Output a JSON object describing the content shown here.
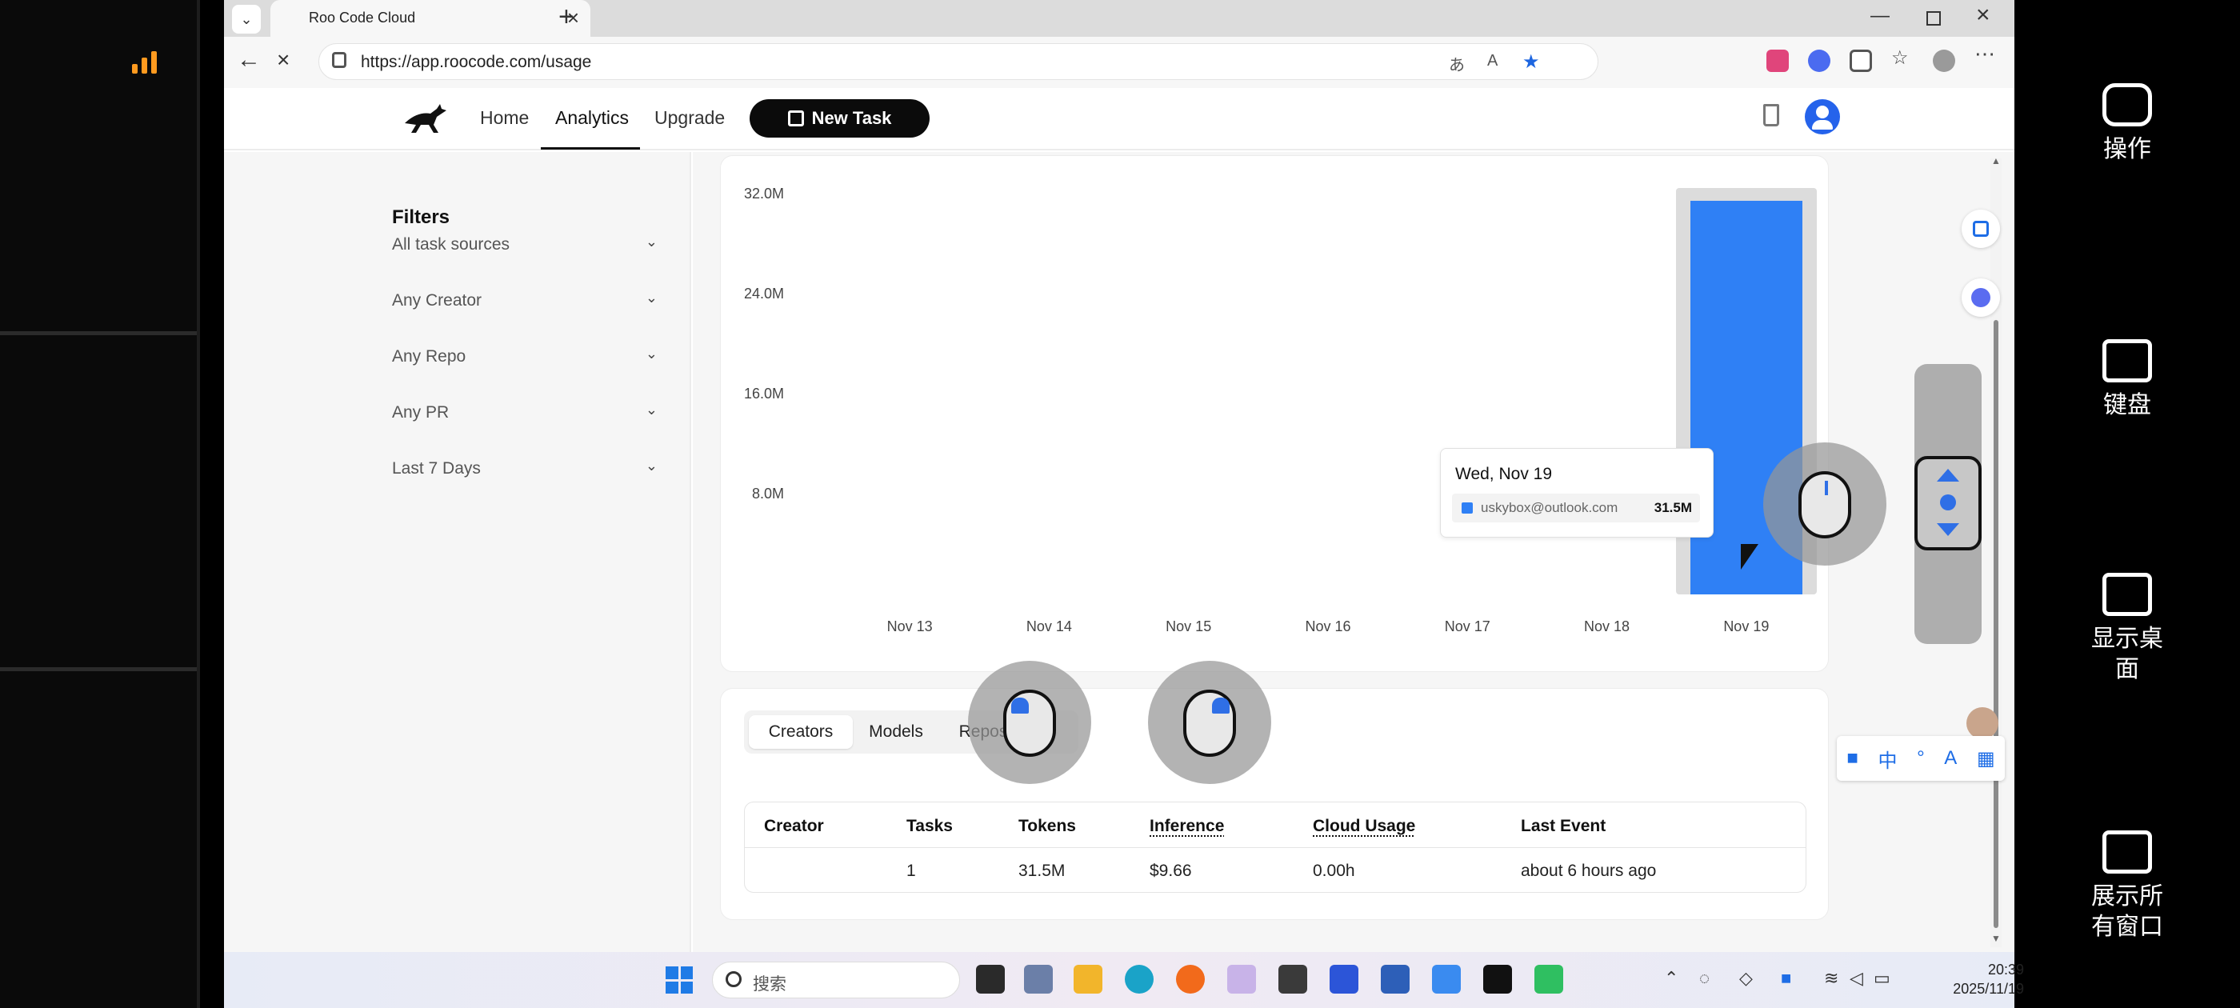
{
  "browser": {
    "tab_title": "Roo Code Cloud",
    "url": "https://app.roocode.com/usage"
  },
  "nav": {
    "home": "Home",
    "analytics": "Analytics",
    "upgrade": "Upgrade",
    "new_task": "New Task"
  },
  "filters": {
    "title": "Filters",
    "items": [
      "All task sources",
      "Any Creator",
      "Any Repo",
      "Any PR",
      "Last 7 Days"
    ]
  },
  "chart_data": {
    "type": "bar",
    "categories": [
      "Nov 13",
      "Nov 14",
      "Nov 15",
      "Nov 16",
      "Nov 17",
      "Nov 18",
      "Nov 19"
    ],
    "series": [
      {
        "name": "uskybox@outlook.com",
        "values": [
          0,
          0,
          0,
          0,
          0,
          0,
          31.5
        ]
      }
    ],
    "y_ticks": [
      "32.0M",
      "24.0M",
      "16.0M",
      "8.0M"
    ],
    "ylim": [
      0,
      32
    ],
    "unit": "M tokens",
    "color": "#2f80f5",
    "tooltip": {
      "date": "Wed, Nov 19",
      "label": "uskybox@outlook.com",
      "value": "31.5M"
    }
  },
  "tabs": [
    "Creators",
    "Models",
    "Repositories"
  ],
  "table": {
    "headers": [
      "Creator",
      "Tasks",
      "Tokens",
      "Inference",
      "Cloud Usage",
      "Last Event"
    ],
    "rows": [
      [
        "",
        "1",
        "31.5M",
        "$9.66",
        "0.00h",
        "about 6 hours ago"
      ]
    ]
  },
  "right_panel": {
    "operate": "操作",
    "keyboard": "键盘",
    "show_desktop": "显示桌面",
    "show_all_windows": "展示所有窗口"
  },
  "ime": [
    "中"
  ],
  "taskbar": {
    "search_placeholder": "搜索",
    "time": "20:39",
    "date": "2025/11/19"
  }
}
